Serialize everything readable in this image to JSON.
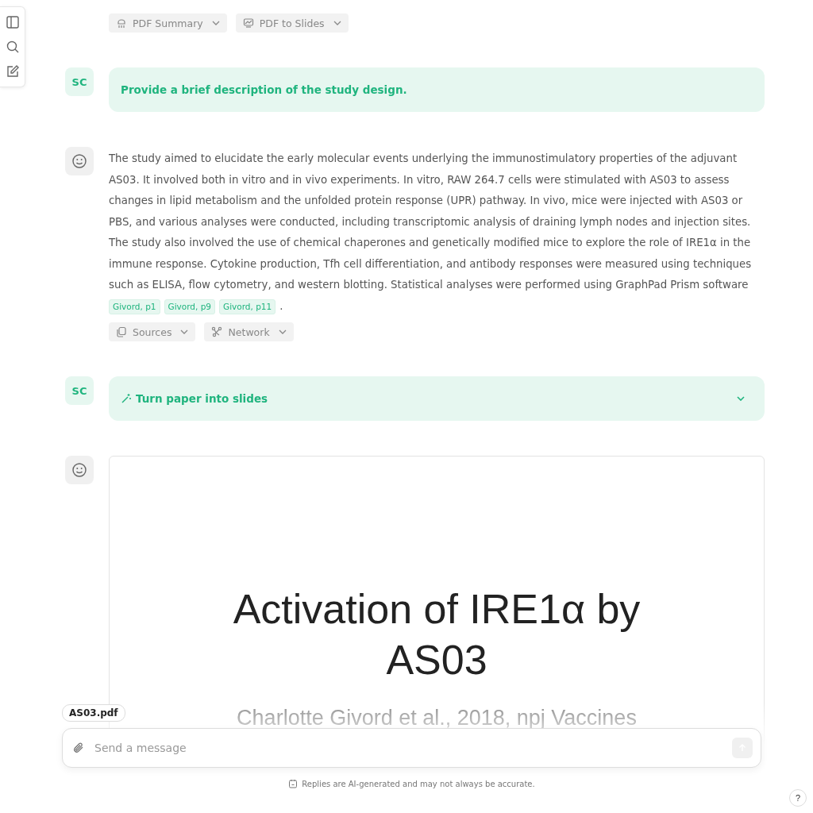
{
  "top_actions": [
    {
      "label": "PDF Summary"
    },
    {
      "label": "PDF to Slides"
    }
  ],
  "messages": [
    {
      "kind": "user",
      "avatar": "SC",
      "text": "Provide a brief description of the study design."
    },
    {
      "kind": "assistant",
      "text": "The study aimed to elucidate the early molecular events underlying the immunostimulatory properties of the adjuvant AS03. It involved both in vitro and in vivo experiments. In vitro, RAW 264.7 cells were stimulated with AS03 to assess changes in lipid metabolism and the unfolded protein response (UPR) pathway. In vivo, mice were injected with AS03 or PBS, and various analyses were conducted, including transcriptomic analysis of draining lymph nodes and injection sites. The study also involved the use of chemical chaperones and genetically modified mice to explore the role of IRE1α in the immune response. Cytokine production, Tfh cell differentiation, and antibody responses were measured using techniques such as ELISA, flow cytometry, and western blotting. Statistical analyses were performed using GraphPad Prism software",
      "citations": [
        "Givord, p1",
        "Givord, p9",
        "Givord, p11"
      ],
      "end": ".",
      "actions": [
        {
          "label": "Sources"
        },
        {
          "label": "Network"
        }
      ]
    },
    {
      "kind": "command",
      "avatar": "SC",
      "text": "Turn paper into slides",
      "expanded": false
    },
    {
      "kind": "slide",
      "title": "Activation of IRE1α by AS03",
      "subtitle": "Charlotte Givord et al., 2018, npj Vaccines"
    }
  ],
  "attachment": "AS03.pdf",
  "composer": {
    "placeholder": "Send a message"
  },
  "disclaimer": "Replies are AI-generated and may not always be accurate.",
  "help": "?"
}
